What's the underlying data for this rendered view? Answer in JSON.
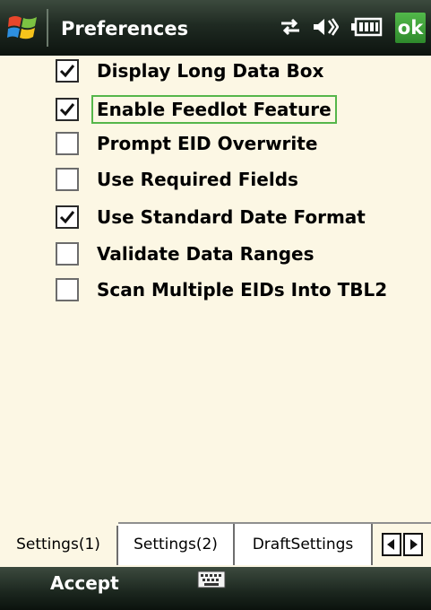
{
  "title_bar": {
    "title": "Preferences",
    "ok_label": "ok",
    "icons": [
      "windows-start-icon",
      "network-sync-icon",
      "volume-icon",
      "battery-icon"
    ]
  },
  "options": [
    {
      "label": "Display Long Data Box",
      "checked": true
    },
    {
      "label": "Enable Feedlot Feature",
      "checked": true,
      "focused": true
    },
    {
      "label": "Prompt EID Overwrite",
      "checked": false
    },
    {
      "label": "Use Required Fields",
      "checked": false
    },
    {
      "label": "Use Standard Date Format",
      "checked": true
    },
    {
      "label": "Validate Data Ranges",
      "checked": false
    },
    {
      "label": "Scan Multiple EIDs Into TBL2",
      "checked": false
    }
  ],
  "tabs": [
    {
      "label": "Settings(1)",
      "active": true
    },
    {
      "label": "Settings(2)",
      "active": false
    },
    {
      "label": "DraftSettings",
      "active": false
    }
  ],
  "menu_bar": {
    "left_softkey": "Accept",
    "keyboard_icon": "keyboard-icon"
  },
  "colors": {
    "background": "#fcf7e4",
    "title_bar": "#1f2a22",
    "ok_button": "#3fa03a",
    "focus_outline": "#55b64a"
  }
}
